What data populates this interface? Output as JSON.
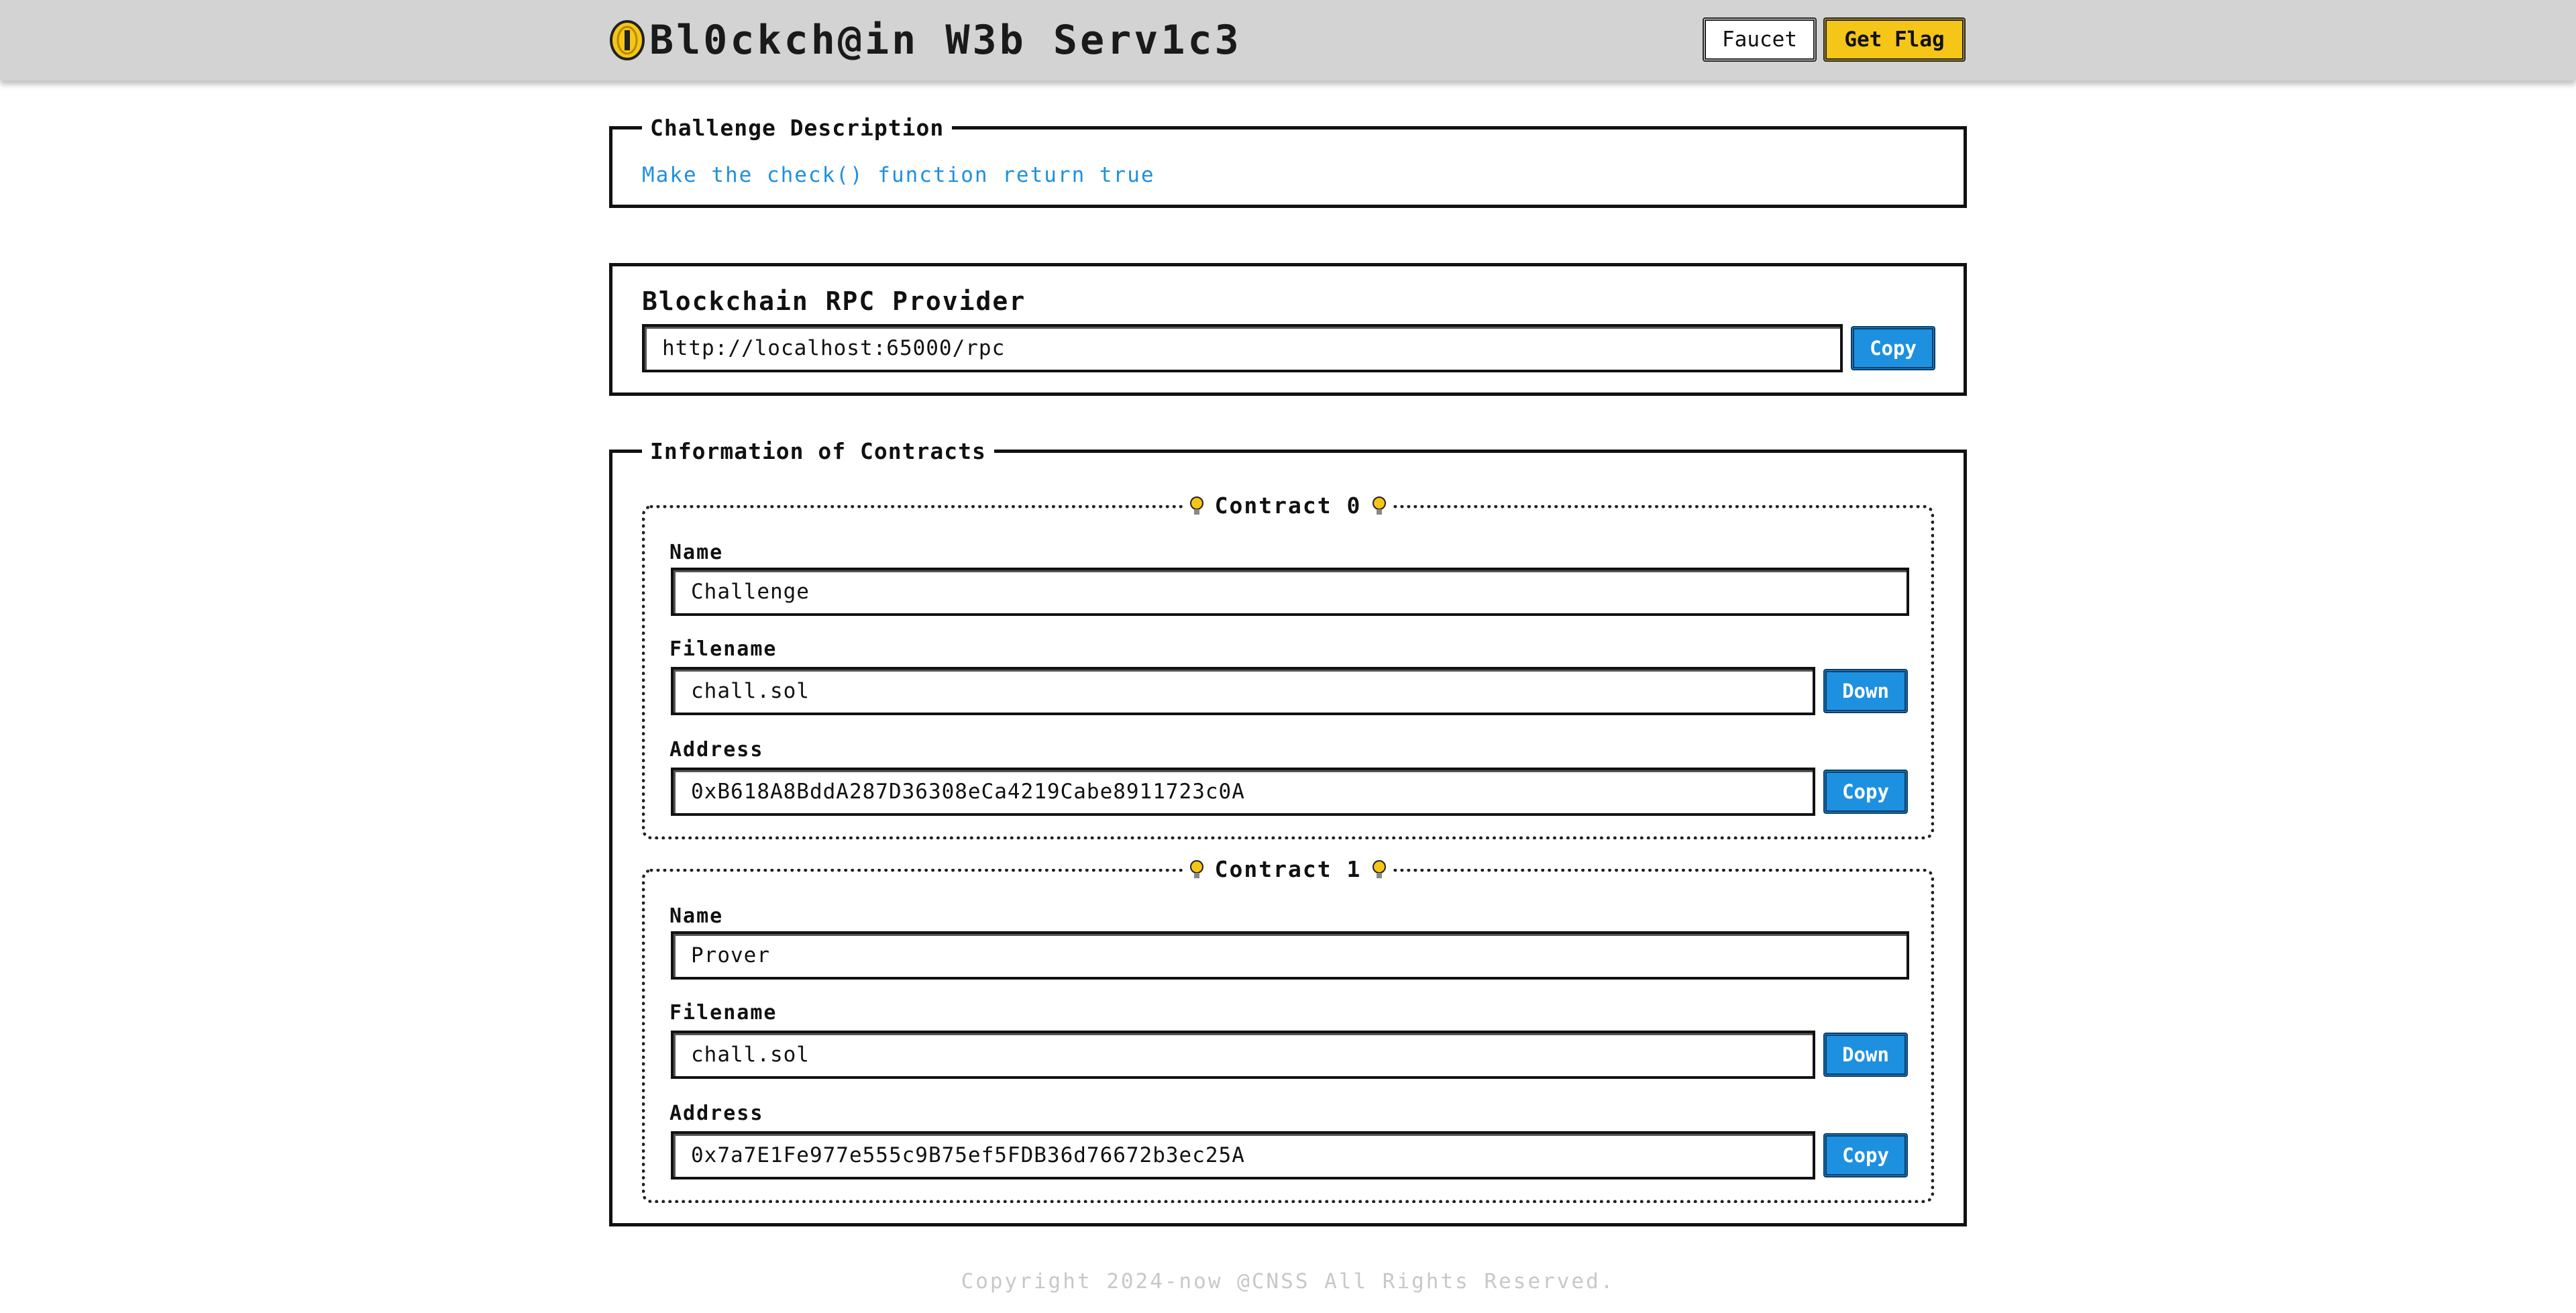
{
  "header": {
    "title": "Bl0ckch@in W3b Serv1c3",
    "faucet_label": "Faucet",
    "getflag_label": "Get Flag",
    "accent_color": "#f5c518",
    "icon": "coin-icon"
  },
  "challenge": {
    "legend": "Challenge Description",
    "text": "Make the check() function return true"
  },
  "rpc": {
    "title": "Blockchain RPC Provider",
    "url": "http://localhost:65000/rpc",
    "copy_label": "Copy"
  },
  "contracts": {
    "legend": "Information of Contracts",
    "items": [
      {
        "title": "Contract 0",
        "name_label": "Name",
        "name": "Challenge",
        "filename_label": "Filename",
        "filename": "chall.sol",
        "down_label": "Down",
        "address_label": "Address",
        "address": "0xB618A8BddA287D36308eCa4219Cabe8911723c0A",
        "copy_label": "Copy"
      },
      {
        "title": "Contract 1",
        "name_label": "Name",
        "name": "Prover",
        "filename_label": "Filename",
        "filename": "chall.sol",
        "down_label": "Down",
        "address_label": "Address",
        "address": "0x7a7E1Fe977e555c9B75ef5FDB36d76672b3ec25A",
        "copy_label": "Copy"
      }
    ]
  },
  "footer": {
    "text": "Copyright 2024-now @CNSS All Rights Reserved."
  },
  "colors": {
    "primary": "#1e90e0",
    "link": "#1e90e0",
    "header_bg": "#d3d3d3"
  }
}
